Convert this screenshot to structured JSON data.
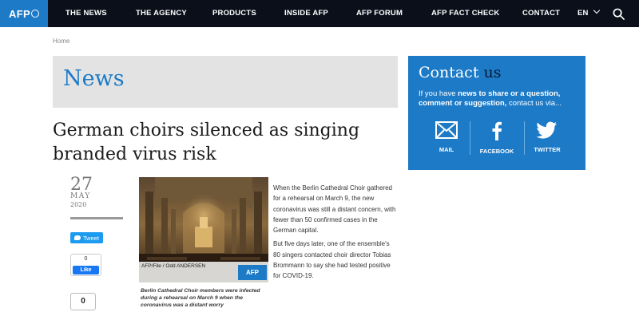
{
  "brand": {
    "logo_text": "AFP"
  },
  "nav": {
    "items": [
      {
        "label": "THE NEWS"
      },
      {
        "label": "THE AGENCY"
      },
      {
        "label": "PRODUCTS"
      },
      {
        "label": "INSIDE AFP"
      },
      {
        "label": "AFP FORUM"
      },
      {
        "label": "AFP FACT CHECK"
      },
      {
        "label": "CONTACT"
      }
    ],
    "language": "EN"
  },
  "breadcrumb": "Home",
  "section_title": "News",
  "article": {
    "headline": "German choirs silenced as singing branded virus risk",
    "date": {
      "day": "27",
      "month": "MAY",
      "year": "2020"
    },
    "paragraphs": [
      "When the Berlin Cathedral Choir gathered for a rehearsal on March 9, the new coronavirus was still a distant concern, with fewer than 50 confirmed cases in the German capital.",
      "But five days later, one of the ensemble's 80 singers contacted choir director Tobias Brommann to say she had tested positive for COVID-19."
    ],
    "photo_credit": "AFP/File / Odd ANDERSEN",
    "photo_logo": "AFP",
    "caption": "Berlin Cathedral Choir members were infected during a rehearsal on March 9 when the coronavirus was a distant worry"
  },
  "share": {
    "tweet_label": "Tweet",
    "fb_count": "0",
    "fb_like_label": "Like",
    "share_count": "0"
  },
  "contact": {
    "title_main": "Contact ",
    "title_accent": "us",
    "text_pre": "If you have ",
    "text_bold": "news to share or a question, comment or suggestion,",
    "text_post": " contact us via...",
    "items": [
      {
        "label": "MAIL",
        "icon": "mail-icon"
      },
      {
        "label": "FACEBOOK",
        "icon": "facebook-icon"
      },
      {
        "label": "TWITTER",
        "icon": "twitter-icon"
      }
    ]
  },
  "colors": {
    "brand_blue": "#1c7ac7",
    "nav_bg": "#0a0f1a",
    "band_gray": "#e3e3e3"
  }
}
